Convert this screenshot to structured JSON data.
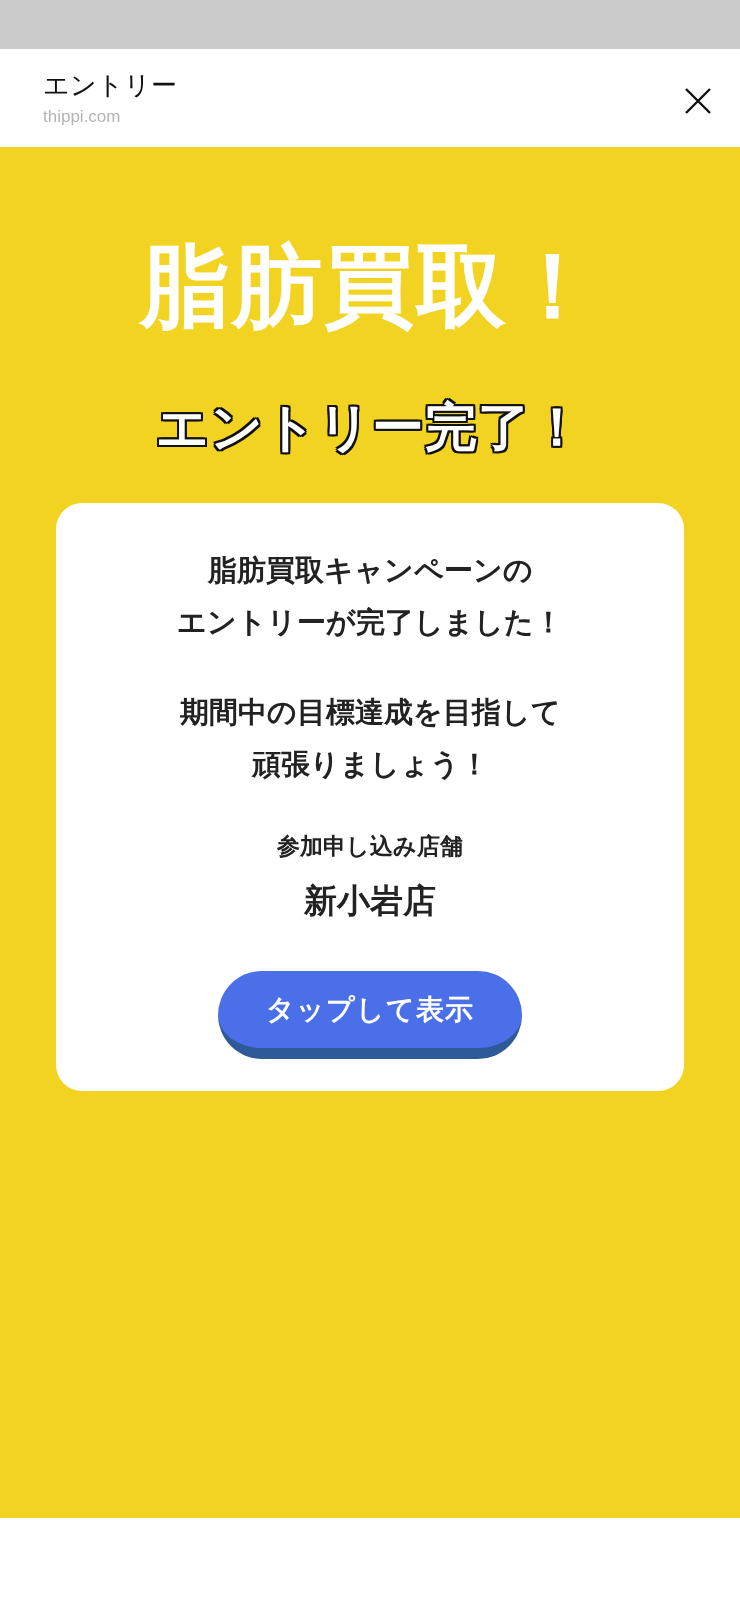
{
  "header": {
    "title": "エントリー",
    "domain": "thippi.com"
  },
  "hero": {
    "title": "脂肪買取！",
    "subtitle": "エントリー完了！"
  },
  "card": {
    "messages": [
      {
        "lines": [
          "脂肪買取キャンペーンの",
          "エントリーが完了しました！"
        ]
      },
      {
        "lines": [
          "期間中の目標達成を目指して",
          "頑張りましょう！"
        ]
      }
    ],
    "store_label": "参加申し込み店舗",
    "store_name": "新小岩店",
    "button": "タップして表示"
  }
}
